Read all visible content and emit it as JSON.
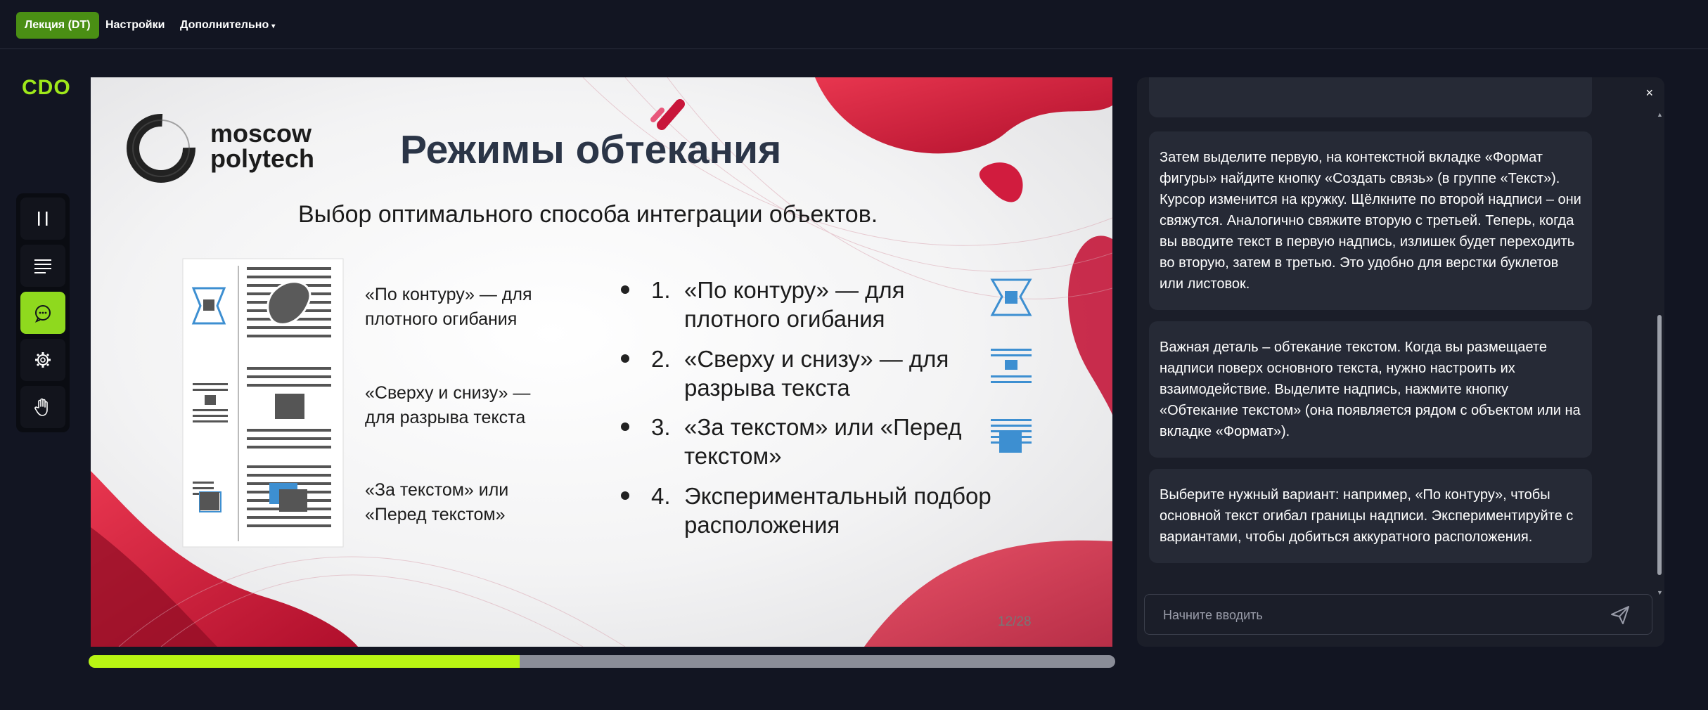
{
  "topbar": {
    "tab_lecture": "Лекция (DT)",
    "tab_settings": "Настройки",
    "tab_more": "Дополнительно"
  },
  "logo": "CDO",
  "toolbar": [
    "pause-icon",
    "list-icon",
    "chat-icon",
    "gear-icon",
    "hand-icon"
  ],
  "slide": {
    "brand_line1": "moscow",
    "brand_line2": "polytech",
    "title": "Режимы обтекания",
    "subtitle": "Выбор оптимального способа интеграции объектов.",
    "left_items": [
      {
        "line1": "«По контуру» — для",
        "line2": "плотного огибания"
      },
      {
        "line1": "«Сверху и снизу» —",
        "line2": "для разрыва текста"
      },
      {
        "line1": "«За текстом» или",
        "line2": "«Перед текстом»"
      }
    ],
    "list_items": [
      {
        "num": "1.",
        "line1": "«По контуру» — для",
        "line2": "плотного огибания"
      },
      {
        "num": "2.",
        "line1": "«Сверху и снизу» — для",
        "line2": "разрыва текста"
      },
      {
        "num": "3.",
        "line1": "«За текстом» или «Перед",
        "line2": "текстом»"
      },
      {
        "num": "4.",
        "line1": "Экспериментальный подбор",
        "line2": "расположения"
      }
    ],
    "page": "12/28"
  },
  "progress": {
    "fraction": 0.42
  },
  "chat": {
    "messages": [
      "Затем выделите первую, на контекстной вкладке «Формат фигуры» найдите кнопку «Создать связь» (в группе «Текст»). Курсор изменится на кружку. Щёлкните по второй надписи – они свяжутся. Аналогично свяжите вторую с третьей. Теперь, когда вы вводите текст в первую надпись, излишек будет переходить во вторую, затем в третью. Это удобно для верстки буклетов или листовок.",
      "Важная деталь – обтекание текстом. Когда вы размещаете надписи поверх основного текста, нужно настроить их взаимодействие. Выделите надпись, нажмите кнопку «Обтекание текстом» (она появляется рядом с объектом или на вкладке «Формат»).",
      "Выберите нужный вариант: например, «По контуру», чтобы основной текст огибал границы надписи. Экспериментируйте с вариантами, чтобы добиться аккуратного расположения."
    ],
    "input_placeholder": "Начните вводить",
    "close": "×"
  },
  "colors": {
    "accent": "#8fd91e",
    "progress": "#b8f513",
    "active_tab": "#4a8f14",
    "slide_red": "#d8173a"
  }
}
